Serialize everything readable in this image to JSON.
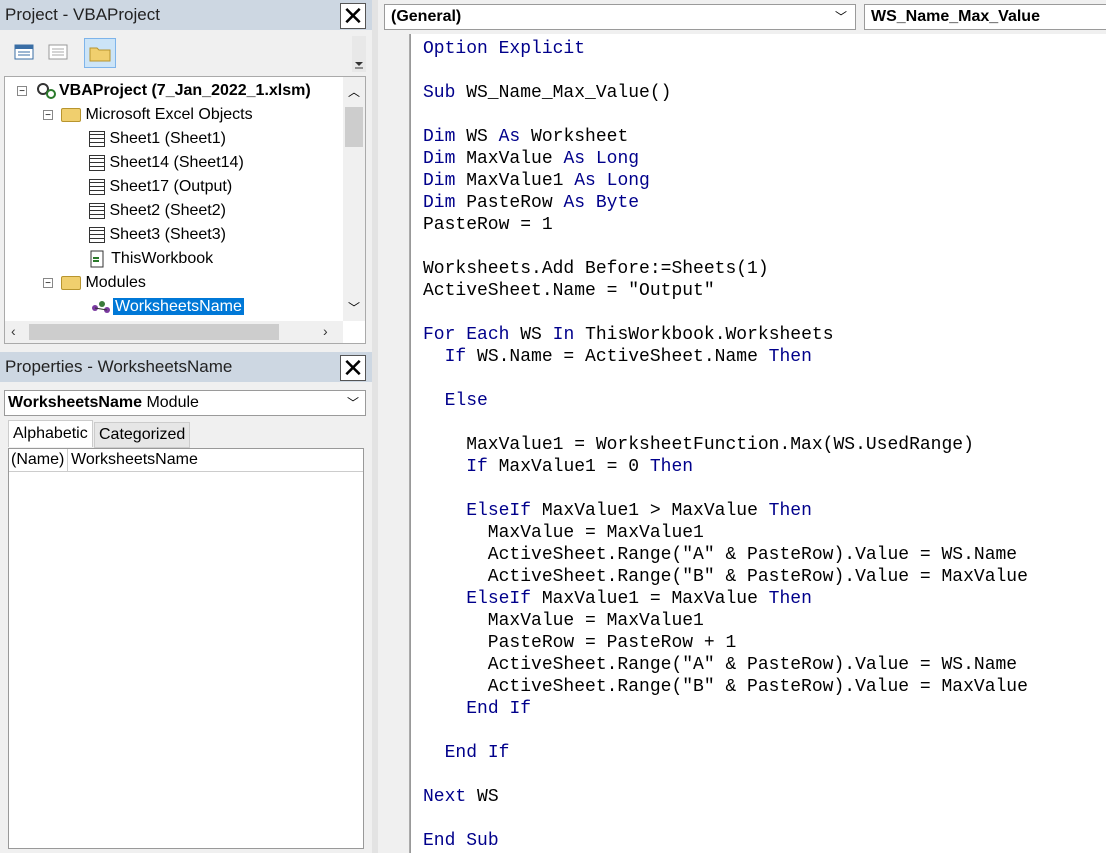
{
  "project_pane": {
    "title": "Project - VBAProject",
    "close": "✕",
    "tree": {
      "root": "VBAProject (7_Jan_2022_1.xlsm)",
      "folder_objects": "Microsoft Excel Objects",
      "sheets": [
        "Sheet1 (Sheet1)",
        "Sheet14 (Sheet14)",
        "Sheet17 (Output)",
        "Sheet2 (Sheet2)",
        "Sheet3 (Sheet3)"
      ],
      "workbook": "ThisWorkbook",
      "folder_modules": "Modules",
      "module": "WorksheetsName"
    }
  },
  "properties_pane": {
    "title": "Properties - WorksheetsName",
    "close": "✕",
    "object_name": "WorksheetsName",
    "object_type": "Module",
    "tabs": [
      "Alphabetic",
      "Categorized"
    ],
    "rows": [
      {
        "name": "(Name)",
        "value": "WorksheetsName"
      }
    ]
  },
  "code_window": {
    "object_combo": "(General)",
    "proc_combo": "WS_Name_Max_Value",
    "lines": [
      "Option Explicit",
      "",
      "Sub WS_Name_Max_Value()",
      "",
      "Dim WS As Worksheet",
      "Dim MaxValue As Long",
      "Dim MaxValue1 As Long",
      "Dim PasteRow As Byte",
      "PasteRow = 1",
      "",
      "Worksheets.Add Before:=Sheets(1)",
      "ActiveSheet.Name = \"Output\"",
      "",
      "For Each WS In ThisWorkbook.Worksheets",
      "  If WS.Name = ActiveSheet.Name Then",
      "",
      "  Else",
      "",
      "    MaxValue1 = WorksheetFunction.Max(WS.UsedRange)",
      "    If MaxValue1 = 0 Then",
      "",
      "    ElseIf MaxValue1 > MaxValue Then",
      "      MaxValue = MaxValue1",
      "      ActiveSheet.Range(\"A\" & PasteRow).Value = WS.Name",
      "      ActiveSheet.Range(\"B\" & PasteRow).Value = MaxValue",
      "    ElseIf MaxValue1 = MaxValue Then",
      "      MaxValue = MaxValue1",
      "      PasteRow = PasteRow + 1",
      "      ActiveSheet.Range(\"A\" & PasteRow).Value = WS.Name",
      "      ActiveSheet.Range(\"B\" & PasteRow).Value = MaxValue",
      "    End If",
      "",
      "  End If",
      "",
      "Next WS",
      "",
      "End Sub"
    ],
    "keyword_color": "#00008b"
  }
}
